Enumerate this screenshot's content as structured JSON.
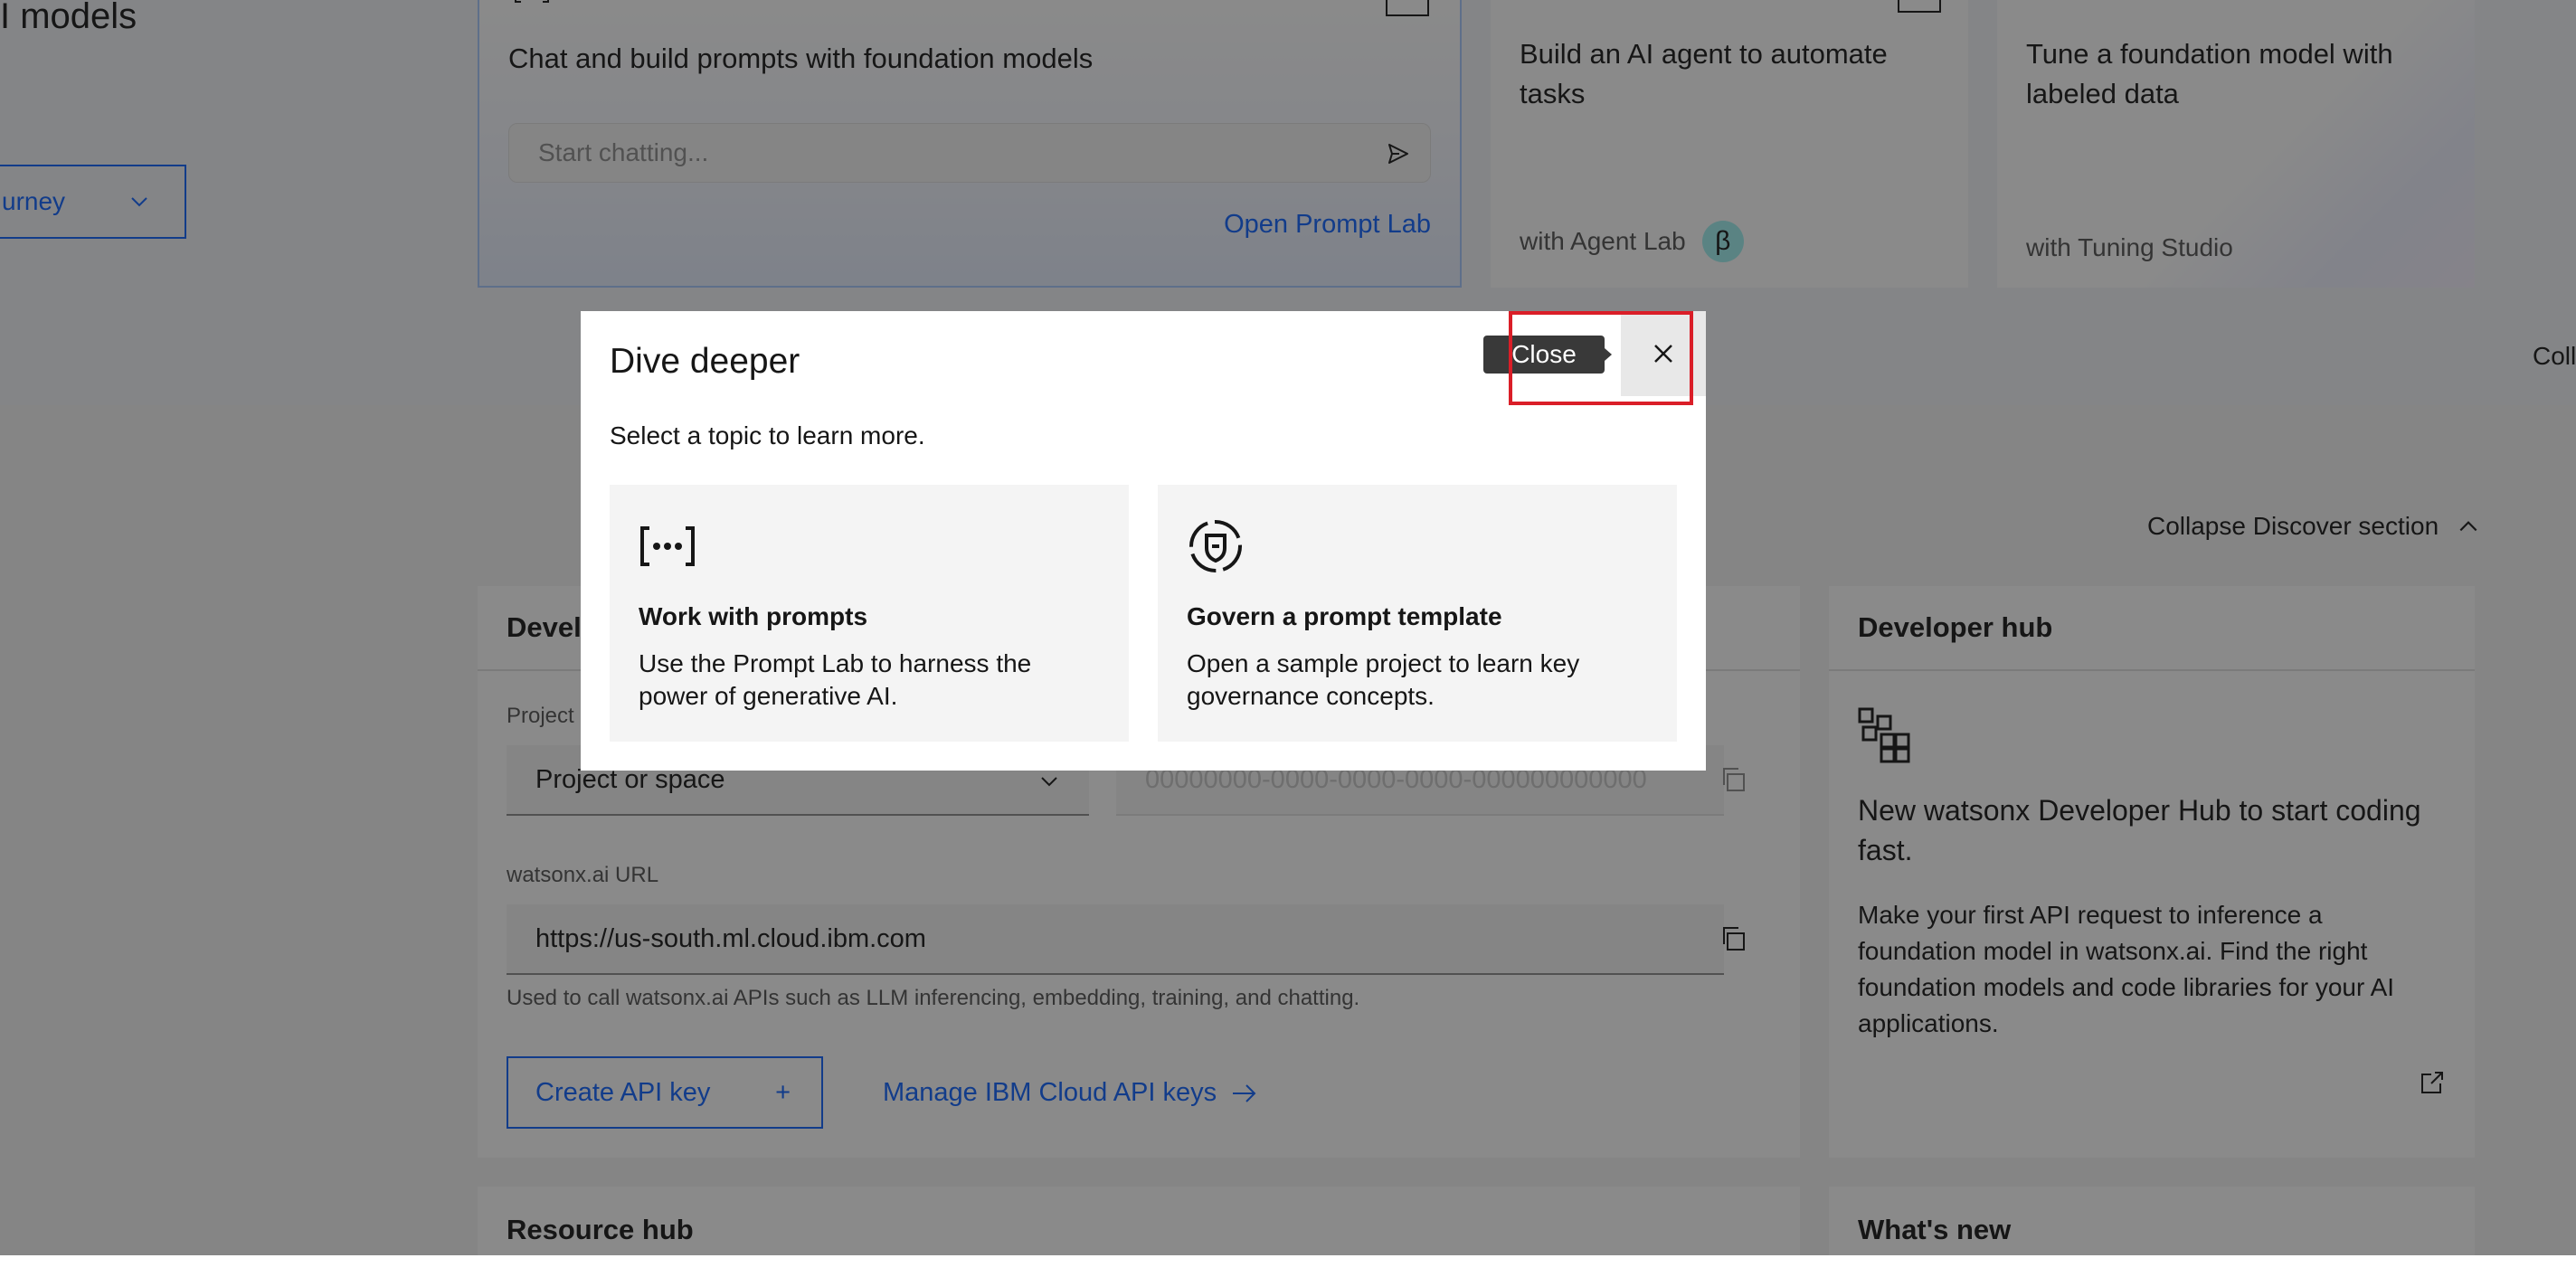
{
  "hero": {
    "title_fragment": "I models",
    "journey_button": "urney"
  },
  "prompt_card": {
    "description": "Chat and build prompts with foundation models",
    "chat_placeholder": "Start chatting...",
    "open_link": "Open Prompt Lab"
  },
  "agent_card": {
    "title": "Build an AI agent to automate tasks",
    "footer": "with Agent Lab",
    "badge": "β"
  },
  "tune_card": {
    "title": "Tune a foundation model with labeled data",
    "footer": "with Tuning Studio"
  },
  "coll_fragment": "Coll",
  "collapse_discover": "Collapse Discover section",
  "developer_access": {
    "title_fragment": "Devel",
    "project_label_fragment": "Project",
    "project_select": "Project or space",
    "id_placeholder": "00000000-0000-0000-0000-000000000000",
    "url_label": "watsonx.ai URL",
    "url_value": "https://us-south.ml.cloud.ibm.com",
    "url_helper": "Used to call watsonx.ai APIs such as LLM inferencing, embedding, training, and chatting.",
    "create_key": "Create API key",
    "create_key_plus": "+",
    "manage_keys": "Manage IBM Cloud API keys"
  },
  "developer_hub": {
    "title": "Developer hub",
    "heading": "New watsonx Developer Hub to start coding fast.",
    "description": "Make your first API request to inference a foundation model in watsonx.ai. Find the right foundation models and code libraries for your AI applications."
  },
  "resource_hub": {
    "title": "Resource hub"
  },
  "whats_new": {
    "title": "What's new"
  },
  "modal": {
    "title": "Dive deeper",
    "subtitle": "Select a topic to learn more.",
    "close_tooltip": "Close",
    "topics": [
      {
        "title": "Work with prompts",
        "description": "Use the Prompt Lab to harness the power of generative AI.",
        "icon": "prompt-brackets-icon"
      },
      {
        "title": "Govern a prompt template",
        "description": "Open a sample project to learn key governance concepts.",
        "icon": "governance-shield-icon"
      }
    ]
  },
  "colors": {
    "accent": "#0f62fe",
    "highlight": "#da1e28",
    "overlay": "rgba(22,22,22,0.5)"
  }
}
